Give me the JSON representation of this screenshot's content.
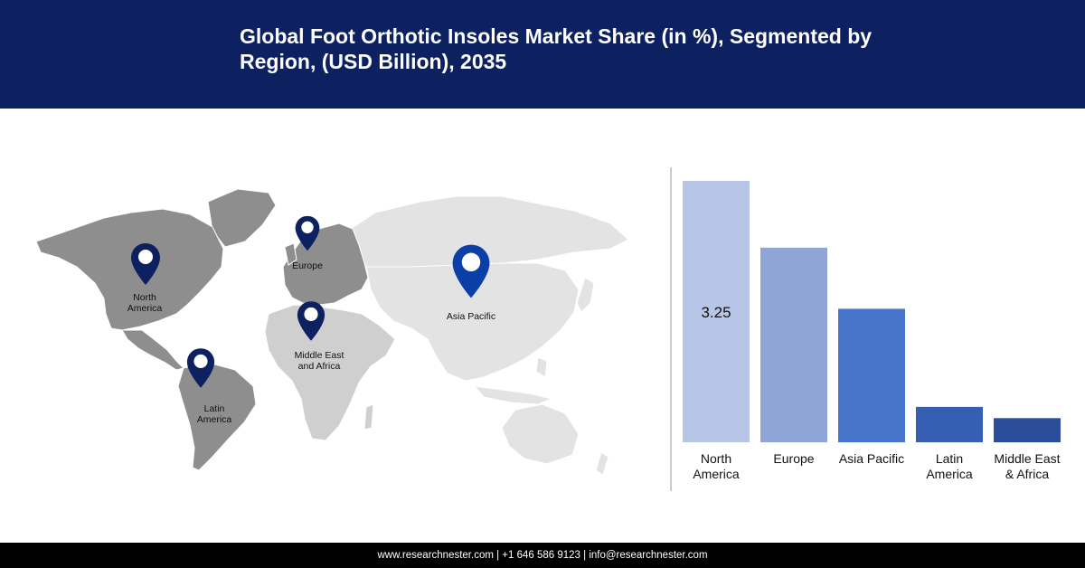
{
  "header": {
    "title": "Global Foot Orthotic Insoles Market Share (in %), Segmented by Region, (USD Billion), 2035"
  },
  "map": {
    "pins": [
      {
        "id": "north-america",
        "label": "North\nAmerica",
        "color": "#0d2060"
      },
      {
        "id": "europe",
        "label": "Europe",
        "color": "#0d2060"
      },
      {
        "id": "asia-pacific",
        "label": "Asia Pacific",
        "color": "#0b3fa8"
      },
      {
        "id": "middle-east-africa",
        "label": "Middle East\nand Africa",
        "color": "#0d2060"
      },
      {
        "id": "latin-america",
        "label": "Latin\nAmerica",
        "color": "#0d2060"
      }
    ]
  },
  "chart_data": {
    "type": "bar",
    "categories": [
      "North America",
      "Europe",
      "Asia Pacific",
      "Latin America",
      "Middle East & Africa"
    ],
    "category_lines": [
      [
        "North",
        "America"
      ],
      [
        "Europe"
      ],
      [
        "Asia Pacific"
      ],
      [
        "Latin",
        "America"
      ],
      [
        "Middle East",
        "& Africa"
      ]
    ],
    "values": [
      3.25,
      2.42,
      1.66,
      0.44,
      0.3
    ],
    "data_labels": [
      "3.25",
      "",
      "",
      "",
      ""
    ],
    "colors": [
      "#b7c5e6",
      "#8ea5d6",
      "#4775cc",
      "#365eb3",
      "#2b4d9a"
    ],
    "ylim": [
      0,
      3.25
    ],
    "grid": false,
    "legend": "none"
  },
  "footer": {
    "text": "www.researchnester.com  | +1 646 586 9123 | info@researchnester.com"
  }
}
